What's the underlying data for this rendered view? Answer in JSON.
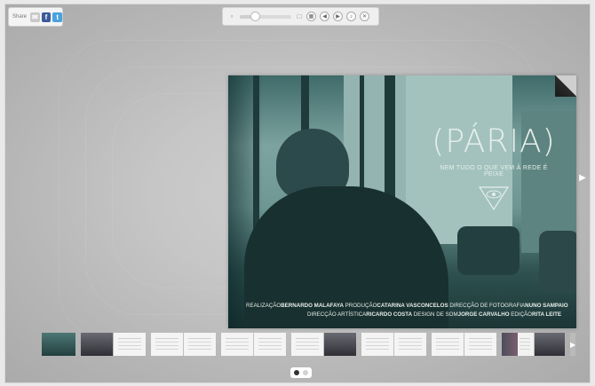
{
  "share": {
    "label": "Share",
    "icons": [
      "mail-icon",
      "facebook-icon",
      "twitter-icon"
    ]
  },
  "toolbar": {
    "zoom_level": 0.3,
    "icons": [
      "zoom-out-icon",
      "zoom-in-icon",
      "grid-icon",
      "prev-icon",
      "next-icon",
      "sound-icon",
      "fullscreen-icon"
    ]
  },
  "page": {
    "title": "(PÁRIA)",
    "tagline": "NEM TUDO O QUE VEM À REDE É PEIXE",
    "credits_line1": [
      {
        "role": "REALIZAÇÃO",
        "name": "BERNARDO MALAFAYA"
      },
      {
        "role": "PRODUÇÃO",
        "name": "CATARINA VASCONCELOS"
      },
      {
        "role": "DIRECÇÃO DE FOTOGRAFIA",
        "name": "NUNO SAMPAIO"
      }
    ],
    "credits_line2": [
      {
        "role": "DIRECÇÃO ARTÍSTICA",
        "name": "RICARDO COSTA"
      },
      {
        "role": "DESIGN DE SOM",
        "name": "JORGE CARVALHO"
      },
      {
        "role": "EDIÇÃO",
        "name": "RITA LEITE"
      }
    ]
  },
  "colors": {
    "page_teal": "#4f7c79",
    "page_dark": "#18302f",
    "text_light": "#e6efe9"
  },
  "pager": {
    "active": 0,
    "count": 2
  }
}
